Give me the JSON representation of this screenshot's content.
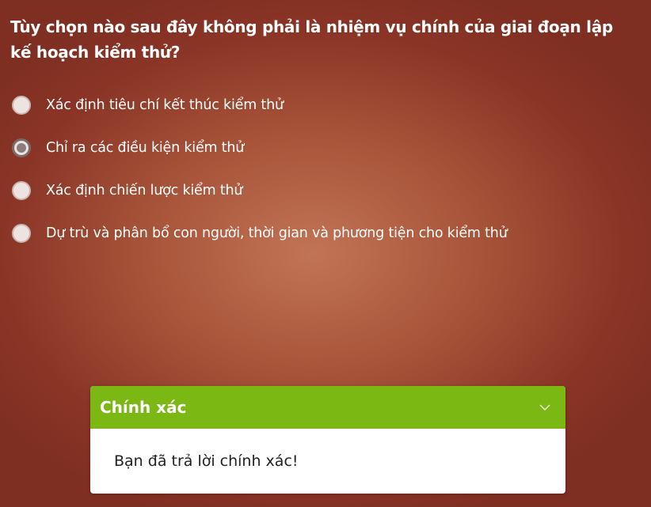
{
  "question": {
    "text": "Tùy chọn nào sau đây không phải là nhiệm vụ chính của giai đoạn lập kế hoạch kiểm thử?"
  },
  "options": [
    {
      "label": "Xác định tiêu chí kết thúc kiểm thử",
      "selected": false
    },
    {
      "label": "Chỉ ra các điều kiện kiểm thử",
      "selected": true
    },
    {
      "label": "Xác định chiến lược kiểm thử",
      "selected": false
    },
    {
      "label": "Dự trù và phân bổ con người, thời gian và phương tiện cho kiểm thử",
      "selected": false
    }
  ],
  "feedback": {
    "title": "Chính xác",
    "message": "Bạn đã trả lời chính xác!",
    "header_color": "#7cb814",
    "toggle_icon": "chevron-down-icon"
  }
}
